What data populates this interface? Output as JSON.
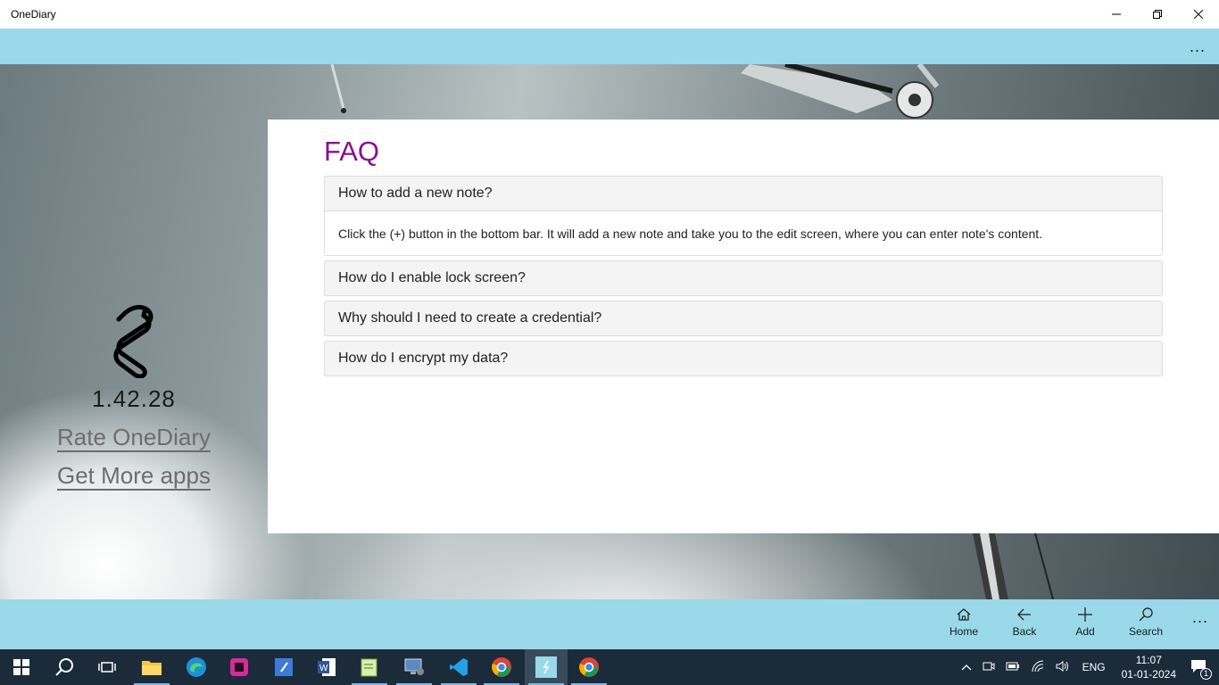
{
  "window": {
    "title": "OneDiary",
    "minimize_icon": "minimize-icon",
    "maximize_icon": "restore-icon",
    "close_icon": "close-icon"
  },
  "topbar": {
    "more_label": "..."
  },
  "side": {
    "logo_icon": "onediary-logo-icon",
    "version": "1.42.28",
    "rate_link": "Rate OneDiary",
    "more_apps_link": "Get More apps"
  },
  "faq": {
    "title": "FAQ",
    "items": [
      {
        "question": "How to add a new note?",
        "answer": "Click the (+) button in the bottom bar. It will add a new note and take you to the edit screen, where you can enter note's content.",
        "expanded": true
      },
      {
        "question": "How do I enable lock screen?",
        "expanded": false
      },
      {
        "question": "Why should I need to create a credential?",
        "expanded": false
      },
      {
        "question": "How do I encrypt my data?",
        "expanded": false
      }
    ]
  },
  "bottombar": {
    "home": "Home",
    "back": "Back",
    "add": "Add",
    "search": "Search",
    "more_label": "..."
  },
  "taskbar": {
    "apps": [
      "start-icon",
      "search-icon",
      "task-view-icon",
      "file-explorer-icon",
      "edge-icon",
      "app-pink-icon",
      "notepad-app-icon",
      "word-icon",
      "notepad-plus-icon",
      "remote-desktop-icon",
      "vscode-icon",
      "chrome-profile-icon",
      "onediary-icon",
      "chrome-icon"
    ],
    "language": "ENG",
    "time": "11:07",
    "date": "01-01-2024",
    "notification_count": "1"
  },
  "colors": {
    "accent_bar": "#99d9ea",
    "faq_title": "#8b0f8b",
    "taskbar": "#1c2b3a"
  }
}
